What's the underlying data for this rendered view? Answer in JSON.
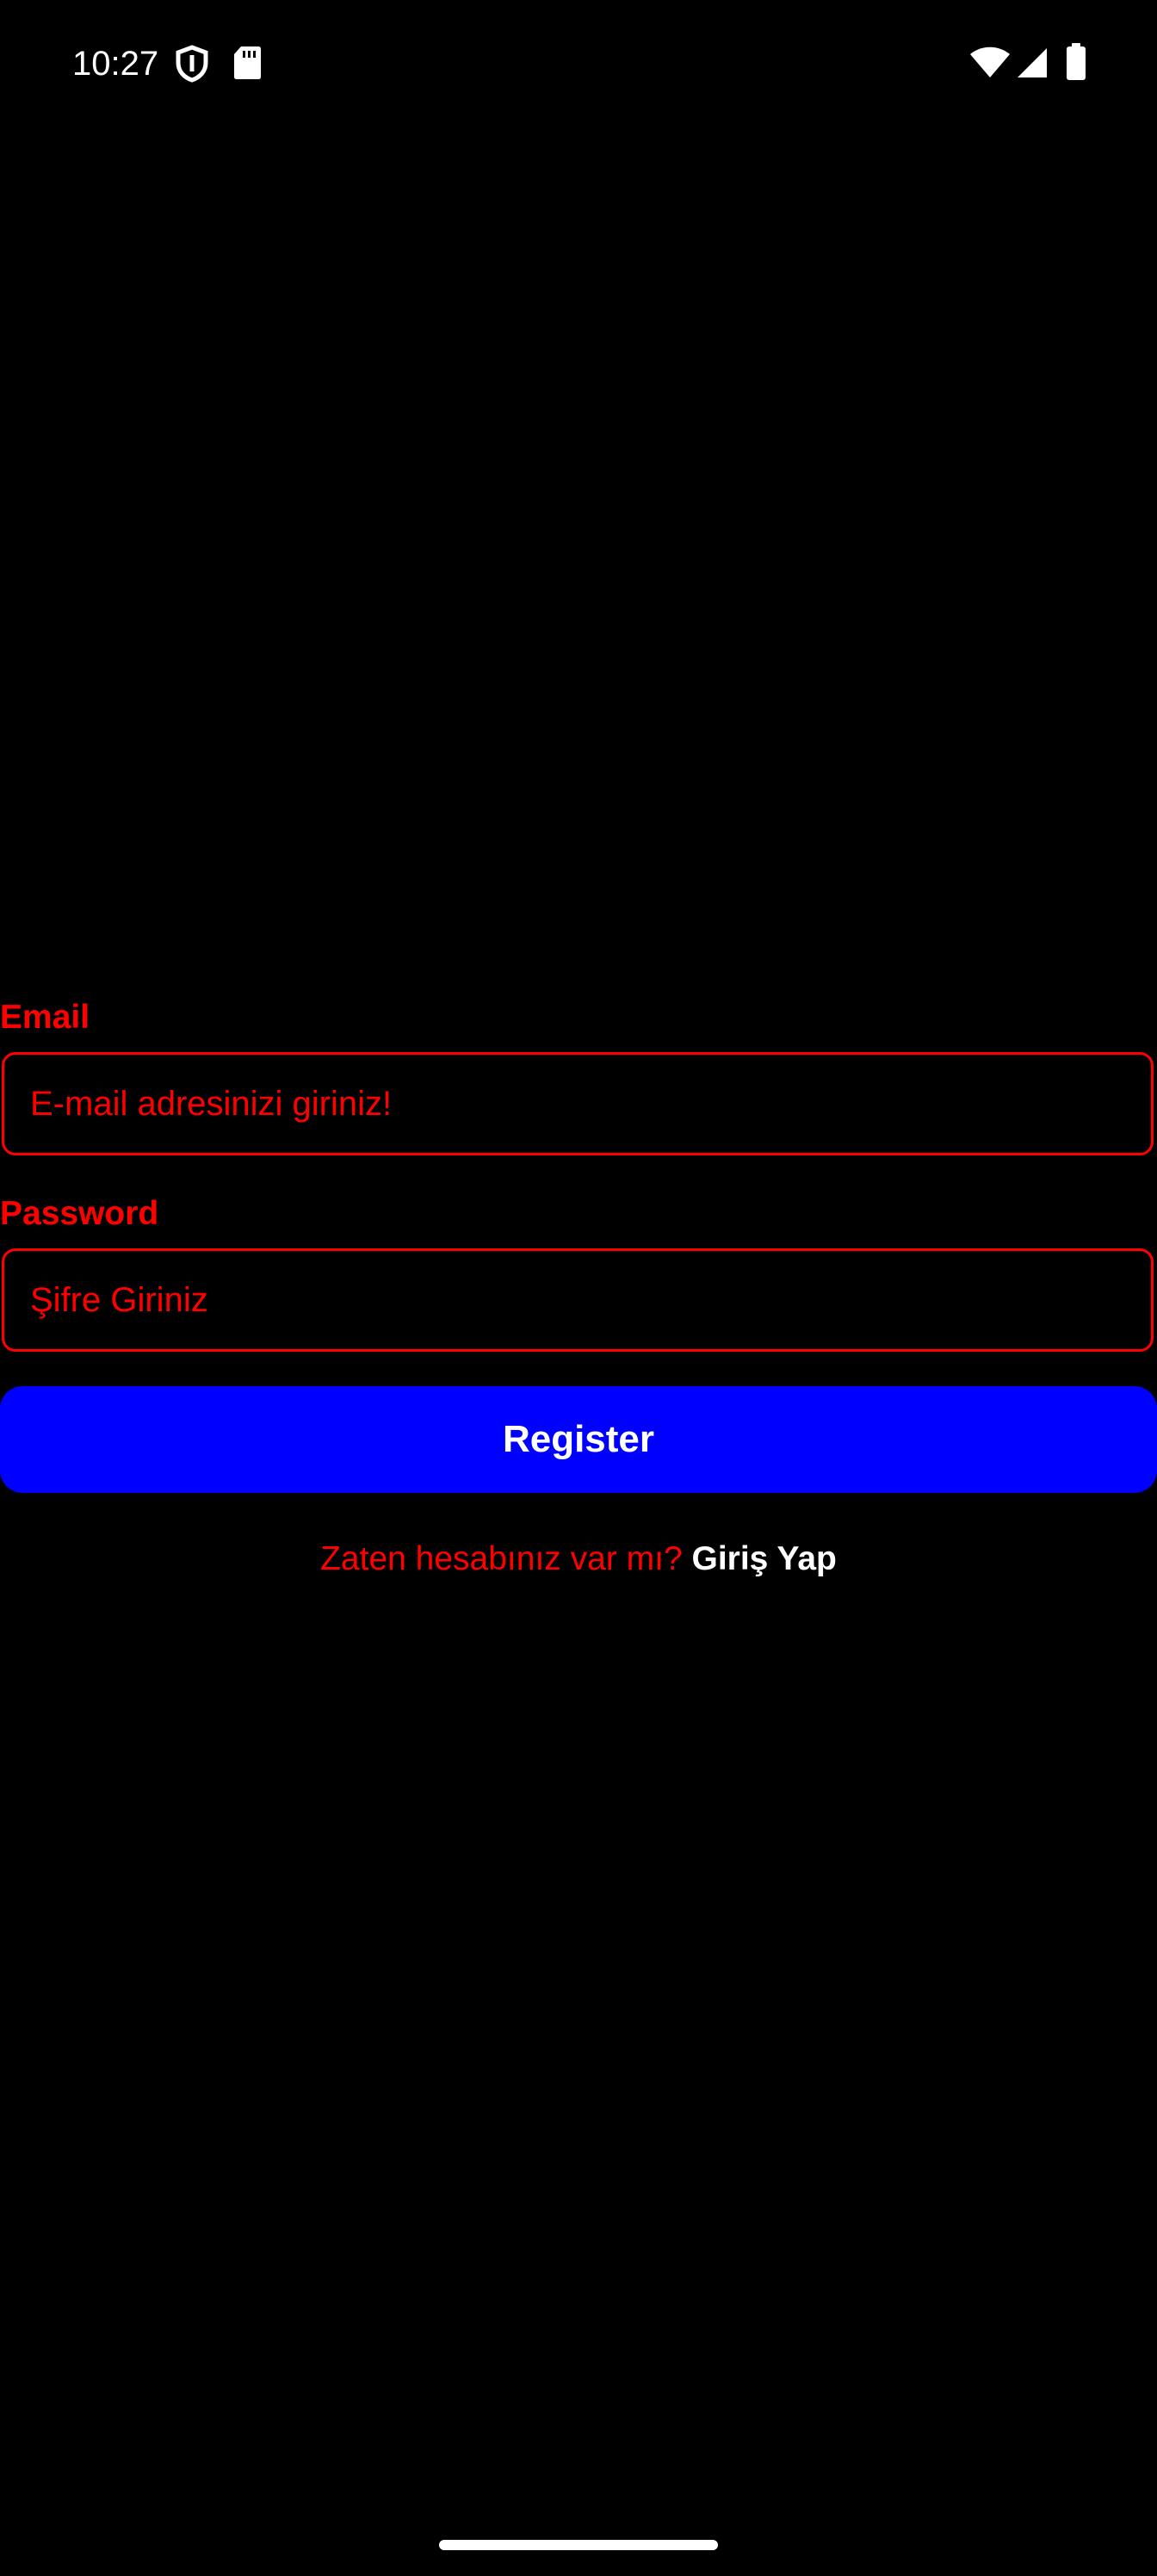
{
  "status_bar": {
    "time": "10:27",
    "left_icons": [
      "shield-icon",
      "sd-card-icon"
    ],
    "right_icons": [
      "wifi-icon",
      "cellular-signal-icon",
      "battery-icon"
    ]
  },
  "form": {
    "email": {
      "label": "Email",
      "placeholder": "E-mail adresinizi giriniz!",
      "value": ""
    },
    "password": {
      "label": "Password",
      "placeholder": "Şifre Giriniz",
      "value": ""
    },
    "register_label": "Register",
    "login_prompt": "Zaten hesabınız var mı?",
    "login_link": "Giriş Yap"
  },
  "colors": {
    "background": "#000000",
    "accent": "#ff0000",
    "button": "#0000ff",
    "button_text": "#ffffff"
  }
}
